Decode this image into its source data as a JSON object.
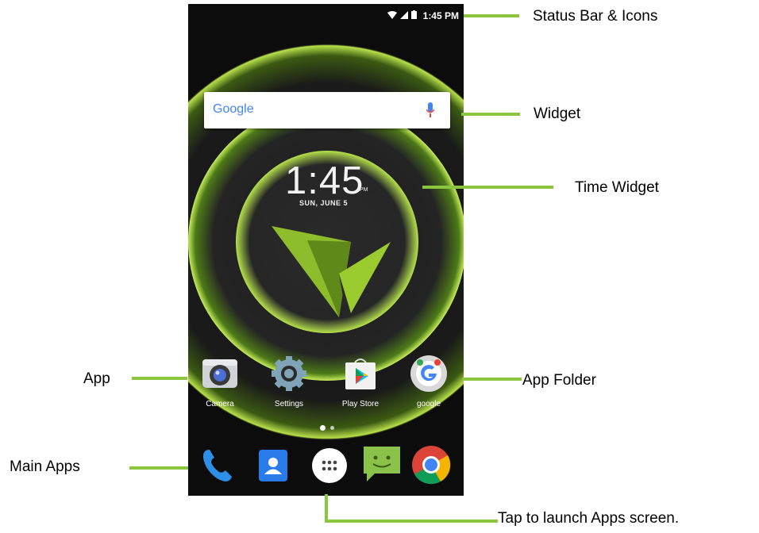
{
  "status_bar": {
    "time": "1:45 PM",
    "icons": [
      "wifi-icon",
      "signal-icon",
      "battery-icon"
    ]
  },
  "search_widget": {
    "logo": "Google",
    "icon": "mic-icon"
  },
  "clock_widget": {
    "time": "1:45",
    "ampm": "PM",
    "date": "SUN, JUNE 5"
  },
  "apps": [
    {
      "label": "Camera",
      "icon": "camera-icon"
    },
    {
      "label": "Settings",
      "icon": "gear-icon"
    },
    {
      "label": "Play Store",
      "icon": "play-store-icon"
    },
    {
      "label": "google",
      "icon": "google-folder-icon"
    }
  ],
  "dock": [
    "phone-icon",
    "contacts-icon",
    "app-drawer-icon",
    "messaging-icon",
    "chrome-icon"
  ],
  "callouts": {
    "status_bar": "Status Bar & Icons",
    "widget": "Widget",
    "time_widget": "Time Widget",
    "app": "App",
    "app_folder": "App Folder",
    "main_apps": "Main Apps",
    "apps_screen": "Tap to launch Apps screen."
  },
  "colors": {
    "accent": "#8cc63e",
    "phone_bg": "#0c0c0c"
  }
}
